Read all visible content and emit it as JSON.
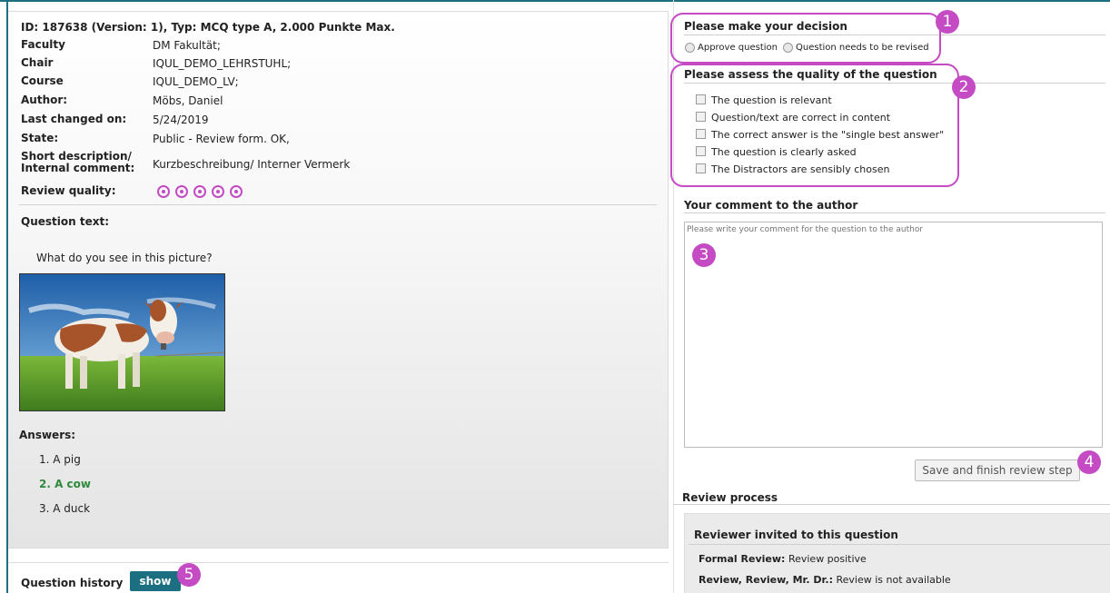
{
  "question": {
    "title": "ID: 187638 (Version: 1), Typ: MCQ type A, 2.000 Punkte Max.",
    "meta": [
      {
        "key": "Faculty",
        "value": "DM Fakultät;"
      },
      {
        "key": "Chair",
        "value": "IQUL_DEMO_LEHRSTUHL;"
      },
      {
        "key": "Course",
        "value": "IQUL_DEMO_LV;"
      },
      {
        "key": "Author:",
        "value": "Möbs, Daniel"
      },
      {
        "key": "Last changed on:",
        "value": "5/24/2019"
      },
      {
        "key": "State:",
        "value": "Public - Review form. OK,"
      },
      {
        "key": "Short description/ Internal comment:",
        "value": "Kurzbeschreibung/ Interner Vermerk"
      }
    ],
    "review_quality_label": "Review quality:",
    "review_quality_rating": 5,
    "question_text_label": "Question text:",
    "question_text": "What do you see in this picture?",
    "answers_label": "Answers:",
    "answers": [
      {
        "text": "1. A pig",
        "correct": false
      },
      {
        "text": "2. A cow",
        "correct": true
      },
      {
        "text": "3. A duck",
        "correct": false
      }
    ],
    "history_label": "Question history",
    "show_button": "show"
  },
  "decision": {
    "heading": "Please make your decision",
    "options": [
      "Approve question",
      "Question needs to be revised"
    ]
  },
  "quality": {
    "heading": "Please assess the quality of the question",
    "criteria": [
      "The question is relevant",
      "Question/text are correct in content",
      "The correct answer is the \"single best answer\"",
      "The question is clearly asked",
      "The Distractors are sensibly chosen"
    ]
  },
  "comment": {
    "heading": "Your comment to the author",
    "placeholder": "Please write your comment for the question to the author"
  },
  "save_button": "Save and finish review step",
  "review_process": {
    "heading": "Review process",
    "box_heading": "Reviewer invited to this question",
    "rows": [
      {
        "label": "Formal Review:",
        "value": "Review positive"
      },
      {
        "label": "Review, Review, Mr. Dr.:",
        "value": "Review is not available"
      }
    ]
  },
  "annotations": [
    "1",
    "2",
    "3",
    "4",
    "5"
  ],
  "colors": {
    "accent": "#1b6f80",
    "highlight": "#c44bc4",
    "correct_answer": "#2e8a3b"
  }
}
